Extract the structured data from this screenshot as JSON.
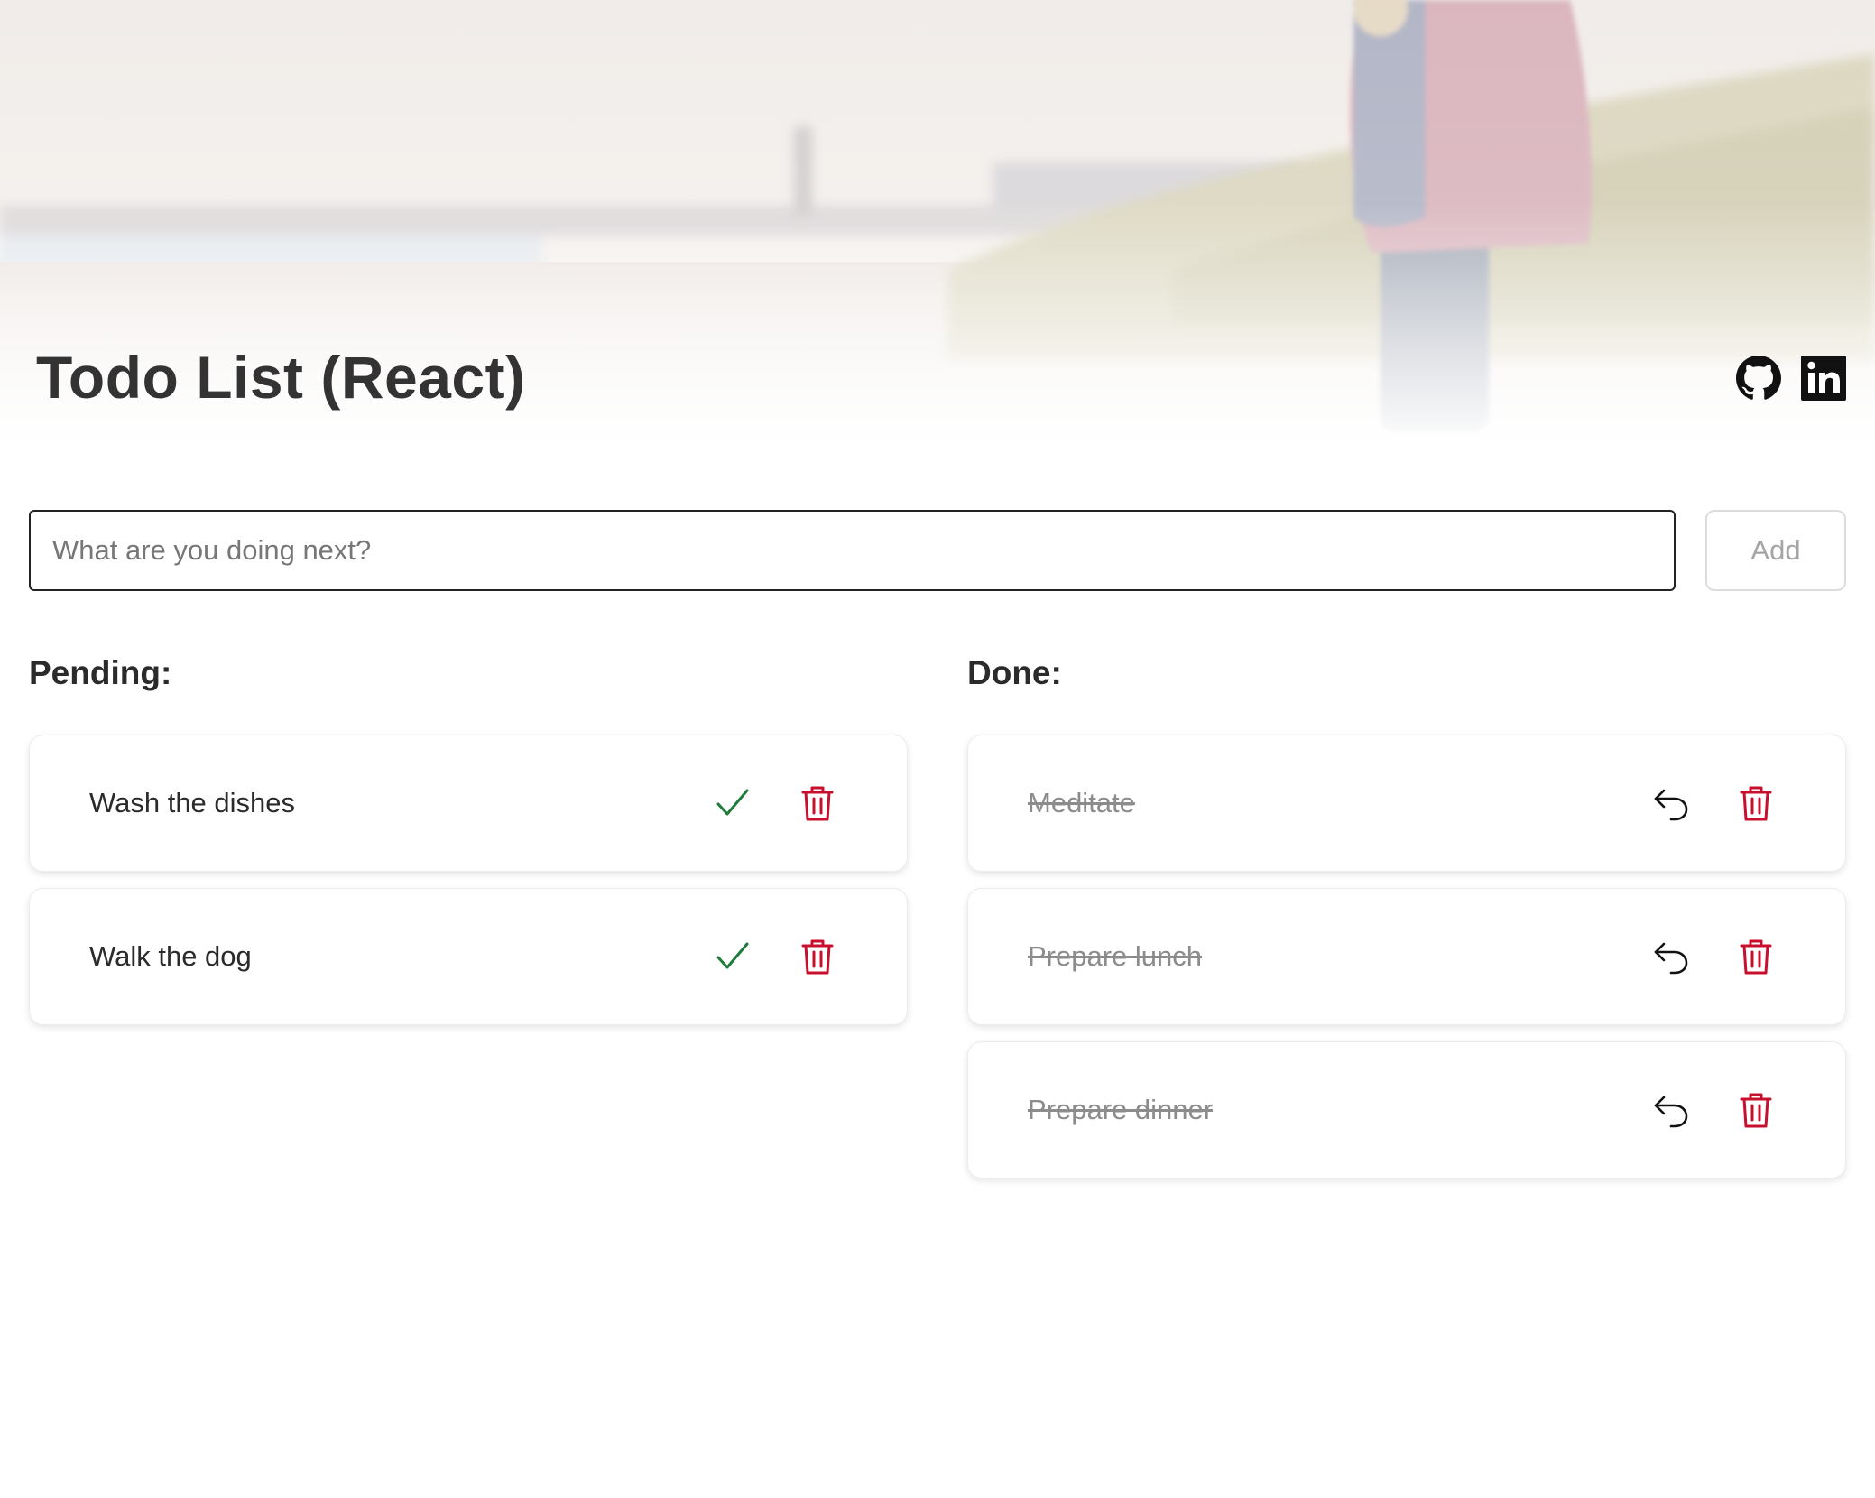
{
  "header": {
    "title": "Todo List (React)",
    "links": [
      {
        "name": "github",
        "icon": "github-icon"
      },
      {
        "name": "linkedin",
        "icon": "linkedin-icon"
      }
    ],
    "background": "blurred-beach-photo"
  },
  "new_todo": {
    "value": "",
    "placeholder": "What are you doing next?",
    "add_label": "Add"
  },
  "pending": {
    "heading": "Pending:",
    "items": [
      {
        "text": "Wash the dishes",
        "actions": [
          "check-icon",
          "trash-icon"
        ]
      },
      {
        "text": "Walk the dog",
        "actions": [
          "check-icon",
          "trash-icon"
        ]
      }
    ]
  },
  "done": {
    "heading": "Done:",
    "items": [
      {
        "text": "Meditate",
        "actions": [
          "undo-icon",
          "trash-icon"
        ]
      },
      {
        "text": "Prepare lunch",
        "actions": [
          "undo-icon",
          "trash-icon"
        ]
      },
      {
        "text": "Prepare dinner",
        "actions": [
          "undo-icon",
          "trash-icon"
        ]
      }
    ]
  },
  "colors": {
    "check": "#1e7b3c",
    "trash": "#c8102e",
    "undo": "#111111",
    "done_text": "#8c8c8c",
    "title": "#333333"
  }
}
